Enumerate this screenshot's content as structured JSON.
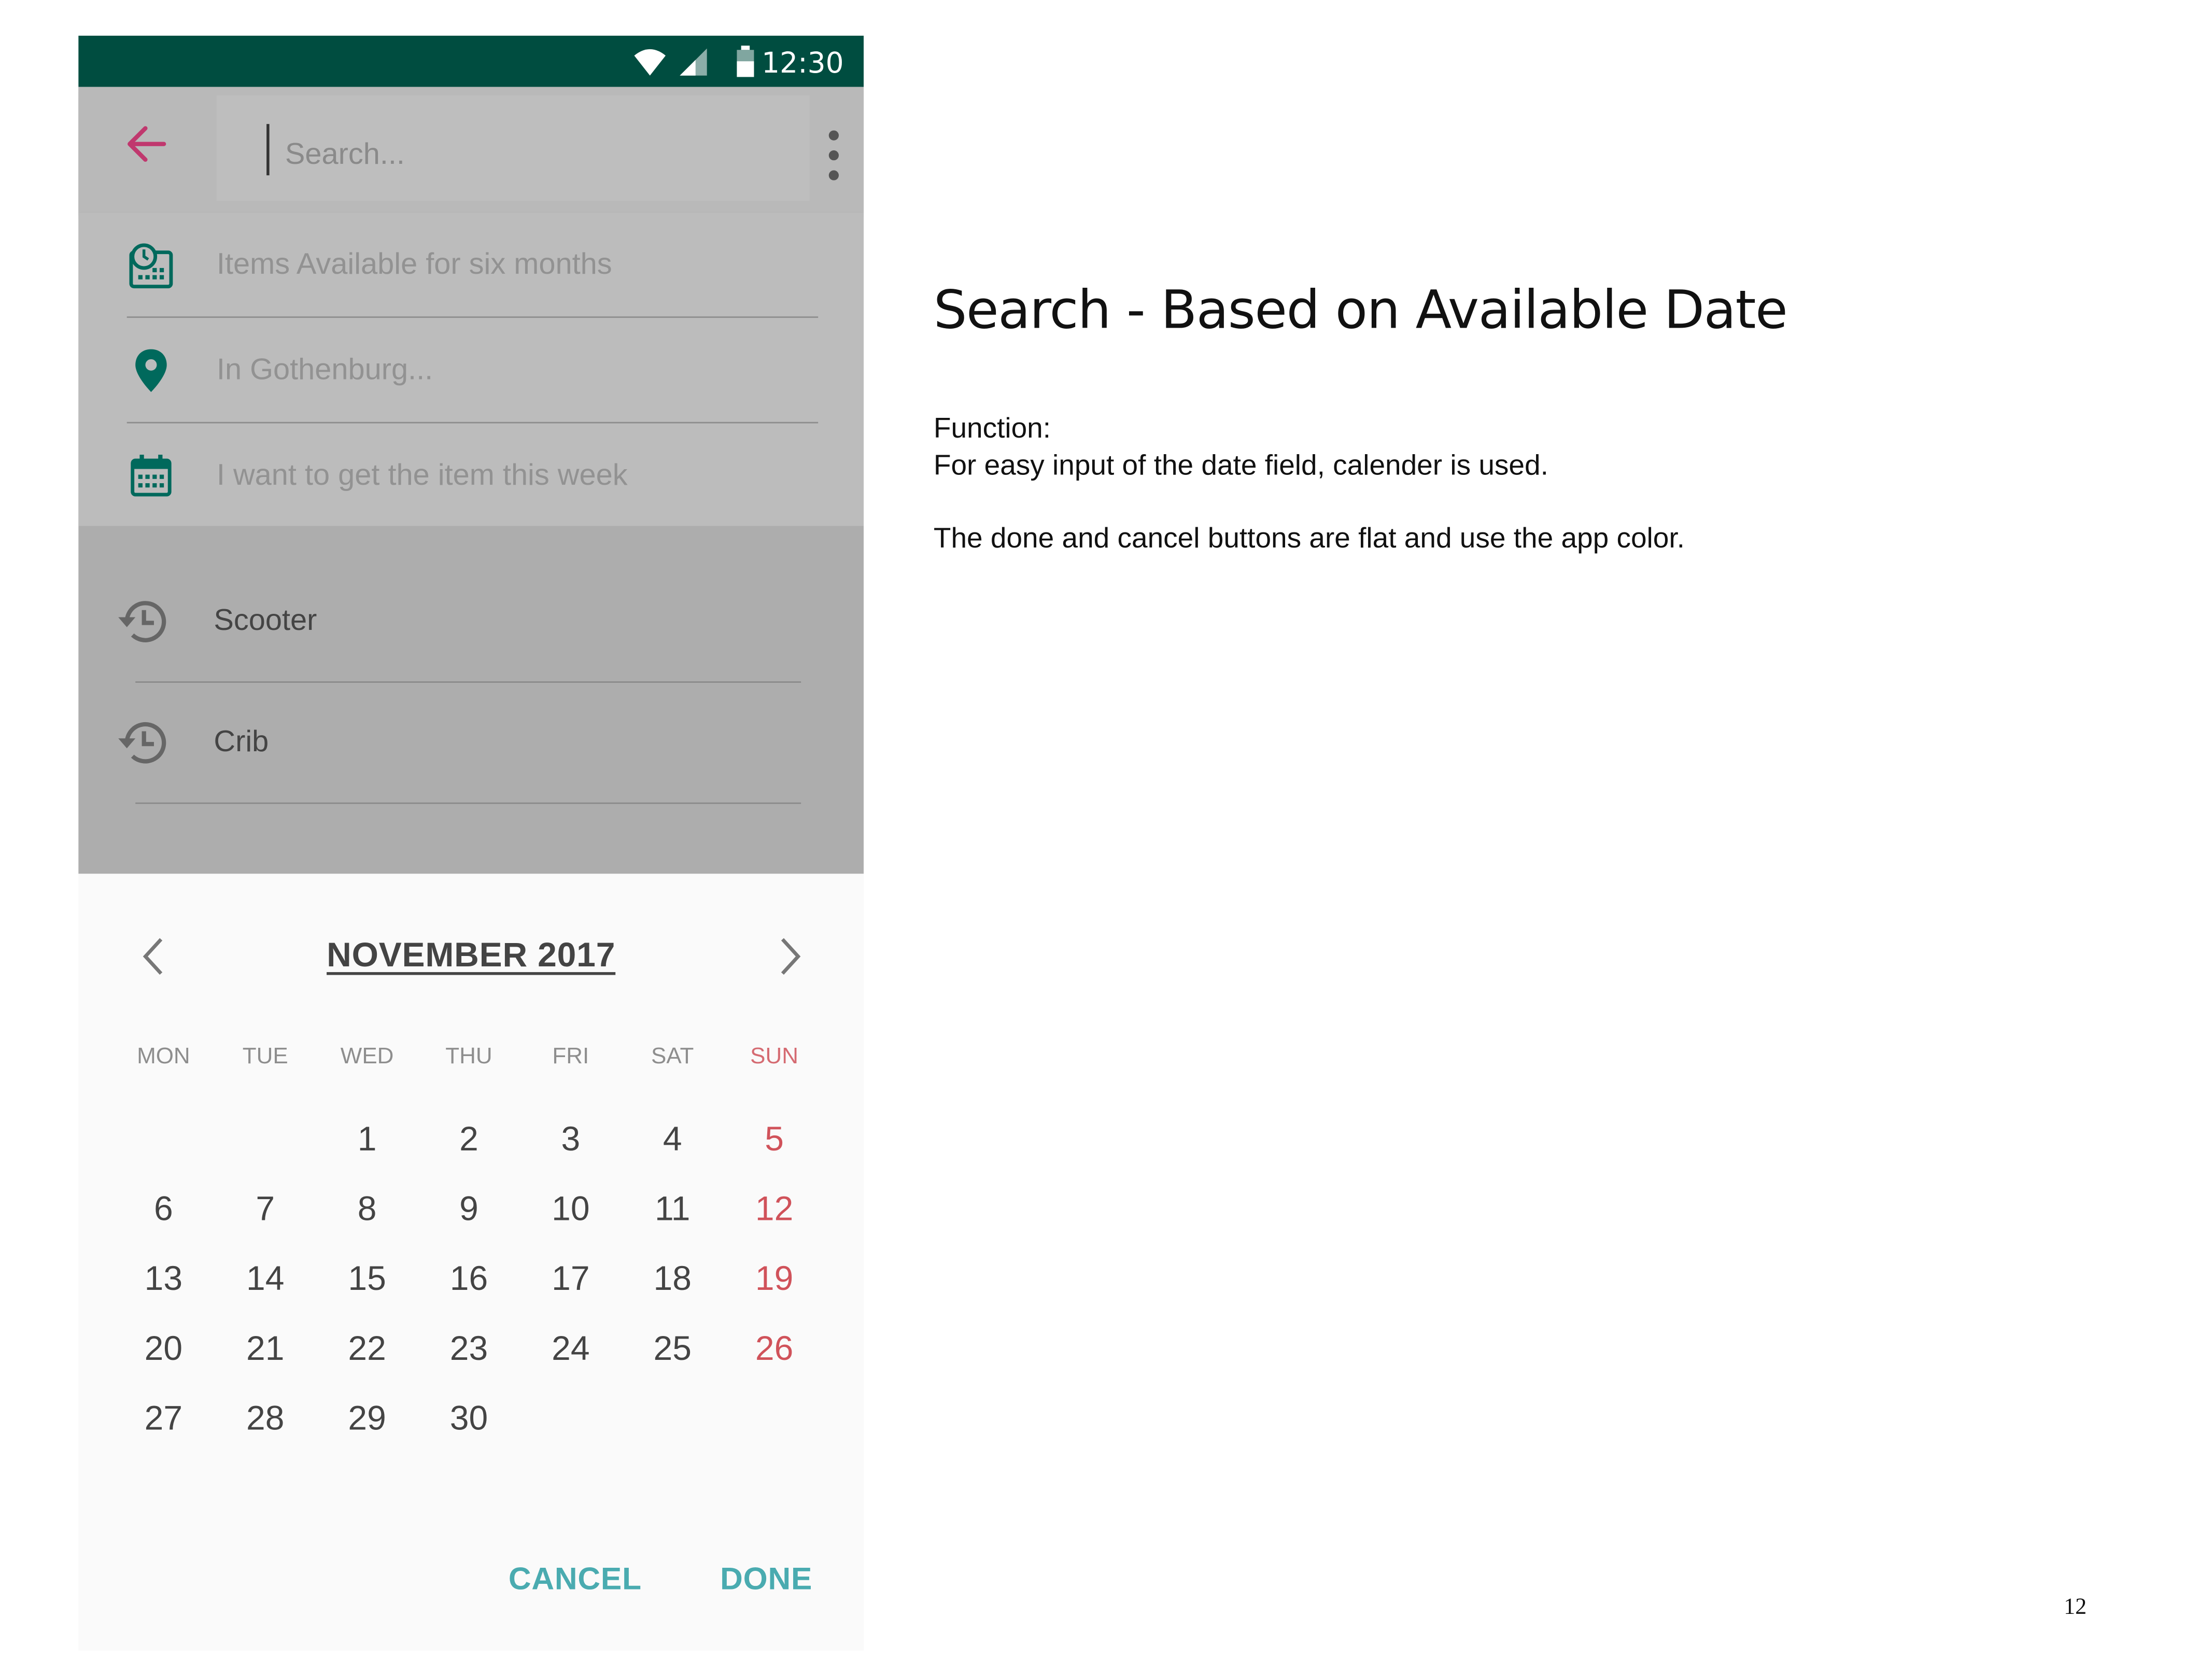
{
  "status_bar": {
    "time": "12:30"
  },
  "search": {
    "placeholder": "Search...",
    "value": ""
  },
  "filters": [
    {
      "icon": "calendar-clock-icon",
      "label": "Items Available for six months"
    },
    {
      "icon": "location-pin-icon",
      "label": "In Gothenburg..."
    },
    {
      "icon": "calendar-icon",
      "label": "I want to get the item this week"
    }
  ],
  "history": [
    {
      "icon": "history-icon",
      "label": "Scooter"
    },
    {
      "icon": "history-icon",
      "label": "Crib"
    }
  ],
  "calendar": {
    "month_label": "NOVEMBER 2017",
    "weekdays": [
      "MON",
      "TUE",
      "WED",
      "THU",
      "FRI",
      "SAT",
      "SUN"
    ],
    "weeks": [
      [
        "",
        "",
        "1",
        "2",
        "3",
        "4",
        "5"
      ],
      [
        "6",
        "7",
        "8",
        "9",
        "10",
        "11",
        "12"
      ],
      [
        "13",
        "14",
        "15",
        "16",
        "17",
        "18",
        "19"
      ],
      [
        "20",
        "21",
        "22",
        "23",
        "24",
        "25",
        "26"
      ],
      [
        "27",
        "28",
        "29",
        "30",
        "",
        "",
        ""
      ]
    ],
    "cancel_label": "CANCEL",
    "done_label": "DONE"
  },
  "description": {
    "heading": "Search - Based on Available Date",
    "function_title": "Function:",
    "line1": "For easy input of the date field, calender is used.",
    "line2": "The done and cancel buttons are flat and use the app color."
  },
  "page_number": "12",
  "colors": {
    "status_bar": "#004d40",
    "accent_teal": "#4aabb0",
    "sunday_red": "#d0525a",
    "back_arrow": "#c2185b",
    "icon_green": "#00695c"
  }
}
